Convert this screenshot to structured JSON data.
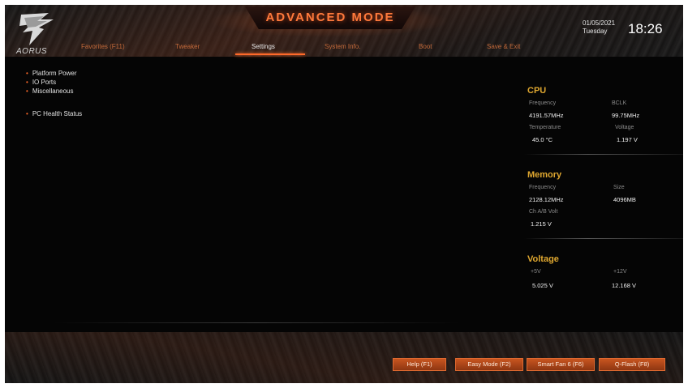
{
  "header": {
    "title": "ADVANCED MODE",
    "logo_text": "AORUS",
    "date": "01/05/2021",
    "day": "Tuesday",
    "time": "18:26"
  },
  "tabs": [
    {
      "label": "Favorites (F11)",
      "active": false
    },
    {
      "label": "Tweaker",
      "active": false
    },
    {
      "label": "Settings",
      "active": true
    },
    {
      "label": "System Info.",
      "active": false
    },
    {
      "label": "Boot",
      "active": false
    },
    {
      "label": "Save & Exit",
      "active": false
    }
  ],
  "menu": {
    "items": [
      {
        "label": "Platform Power"
      },
      {
        "label": "IO Ports"
      },
      {
        "label": "Miscellaneous"
      },
      {
        "label": "PC Health Status"
      }
    ]
  },
  "cpu": {
    "title": "CPU",
    "frequency_label": "Frequency",
    "frequency_value": "4191.57MHz",
    "bclk_label": "BCLK",
    "bclk_value": "99.75MHz",
    "temperature_label": "Temperature",
    "temperature_value": "45.0 °C",
    "voltage_label": "Voltage",
    "voltage_value": "1.197 V"
  },
  "memory": {
    "title": "Memory",
    "frequency_label": "Frequency",
    "frequency_value": "2128.12MHz",
    "size_label": "Size",
    "size_value": "4096MB",
    "chab_label": "Ch A/B Volt",
    "chab_value": "1.215 V"
  },
  "voltage": {
    "title": "Voltage",
    "v5_label": "+5V",
    "v5_value": "5.025 V",
    "v12_label": "+12V",
    "v12_value": "12.168 V"
  },
  "footer": {
    "help": "Help (F1)",
    "easy_mode": "Easy Mode (F2)",
    "smart_fan": "Smart Fan 6 (F6)",
    "qflash": "Q-Flash (F8)"
  },
  "colors": {
    "accent": "#ff6a2a",
    "section_title": "#e0a830",
    "background": "#050505"
  }
}
